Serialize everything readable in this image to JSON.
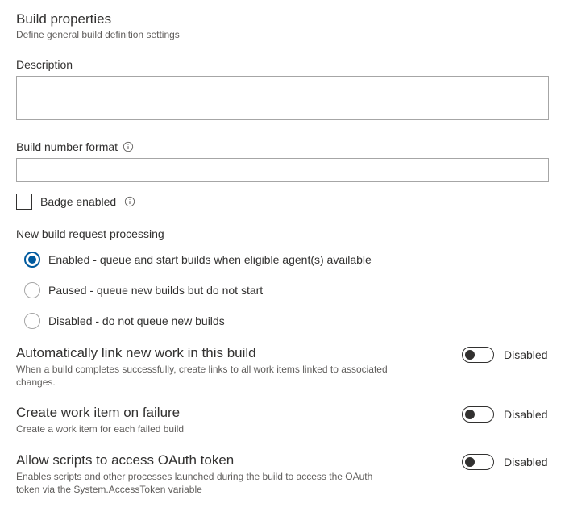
{
  "header": {
    "title": "Build properties",
    "subtitle": "Define general build definition settings"
  },
  "description": {
    "label": "Description",
    "value": ""
  },
  "buildNumberFormat": {
    "label": "Build number format",
    "value": ""
  },
  "badgeEnabled": {
    "label": "Badge enabled",
    "checked": false
  },
  "requestProcessing": {
    "label": "New build request processing",
    "options": [
      {
        "label": "Enabled - queue and start builds when eligible agent(s) available",
        "selected": true
      },
      {
        "label": "Paused - queue new builds but do not start",
        "selected": false
      },
      {
        "label": "Disabled - do not queue new builds",
        "selected": false
      }
    ]
  },
  "toggles": [
    {
      "title": "Automatically link new work in this build",
      "desc": "When a build completes successfully, create links to all work items linked to associated changes.",
      "state": "Disabled",
      "on": false
    },
    {
      "title": "Create work item on failure",
      "desc": "Create a work item for each failed build",
      "state": "Disabled",
      "on": false
    },
    {
      "title": "Allow scripts to access OAuth token",
      "desc": "Enables scripts and other processes launched during the build to access the OAuth token via the System.AccessToken variable",
      "state": "Disabled",
      "on": false
    }
  ]
}
